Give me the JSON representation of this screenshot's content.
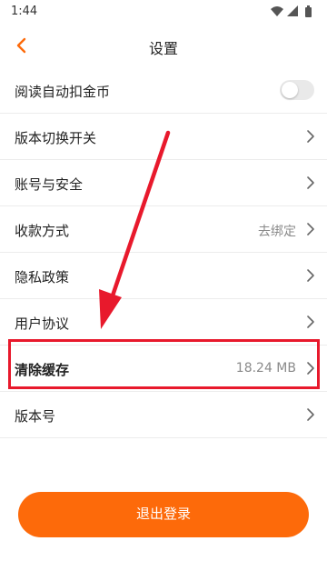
{
  "status_bar": {
    "time": "1:44"
  },
  "header": {
    "title": "设置"
  },
  "settings": {
    "rows": [
      {
        "label": "阅读自动扣金币",
        "control": "toggle",
        "toggle_on": false
      },
      {
        "label": "版本切换开关",
        "control": "chevron"
      },
      {
        "label": "账号与安全",
        "control": "chevron"
      },
      {
        "label": "收款方式",
        "value": "去绑定",
        "control": "chevron"
      },
      {
        "label": "隐私政策",
        "control": "chevron"
      },
      {
        "label": "用户协议",
        "control": "chevron"
      },
      {
        "label": "清除缓存",
        "value": "18.24 MB",
        "control": "chevron",
        "highlighted": true
      },
      {
        "label": "版本号",
        "control": "chevron"
      }
    ]
  },
  "footer": {
    "logout_label": "退出登录"
  },
  "colors": {
    "accent": "#fd6a0a",
    "annotation": "#e8192c",
    "divider": "#ececec",
    "secondary_text": "#8a8a8a"
  },
  "icons": {
    "back": "chevron-left-icon",
    "row_arrow": "chevron-right-icon",
    "status": [
      "wifi-icon",
      "cellular-signal-icon",
      "battery-icon"
    ]
  }
}
